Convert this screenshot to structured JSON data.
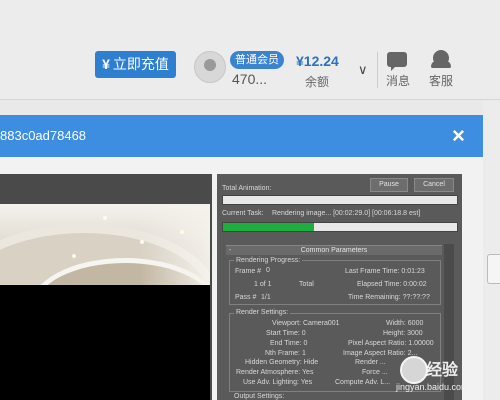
{
  "site_header": {
    "recharge_icon": "¥",
    "recharge_label": "立即充值",
    "member_badge": "普通会员",
    "user_id": "470...",
    "balance": "¥12.24",
    "balance_label": "余额",
    "messages_label": "消息",
    "service_label": "客服"
  },
  "modal": {
    "title": "883c0ad78468",
    "close": "×"
  },
  "render_dialog": {
    "total_animation_label": "Total Animation:",
    "pause_label": "Pause",
    "cancel_label": "Cancel",
    "current_task_label": "Current Task:",
    "current_task_value": "Rendering image... [00:02:29.0] [00:06:18.8 est]",
    "current_task_progress": 0.39,
    "rollout_marker": "-",
    "rollout_title": "Common Parameters",
    "progress": {
      "title": "Rendering Progress:",
      "frame_label": "Frame #",
      "frame_value": "0",
      "of_value": "1 of 1",
      "total_label": "Total",
      "pass_label": "Pass #",
      "pass_value": "1/1",
      "last_frame_time": "Last Frame Time: 0:01:23",
      "elapsed_time": "Elapsed Time: 0:00:02",
      "time_remaining": "Time Remaining: ??:??:??"
    },
    "settings": {
      "title": "Render Settings:",
      "viewport": "Viewport: Camera001",
      "width": "Width: 6000",
      "start_time": "Start Time: 0",
      "height": "Height: 3000",
      "end_time": "End Time: 0",
      "pixel_aspect": "Pixel Aspect Ratio: 1.00000",
      "nth_frame": "Nth Frame: 1",
      "image_aspect": "Image Aspect Ratio: 2...",
      "hidden_geometry": "Hidden Geometry: Hide",
      "render_fields": "Render ...",
      "render_atmosphere": "Render Atmosphere: Yes",
      "force": "Force ...",
      "use_adv_lighting": "Use Adv. Lighting: Yes",
      "compute_adv": "Compute Adv. L..."
    },
    "output_title": "Output Settings:"
  },
  "watermark": {
    "brand": "经验",
    "url": "jingyan.baidu.com"
  }
}
